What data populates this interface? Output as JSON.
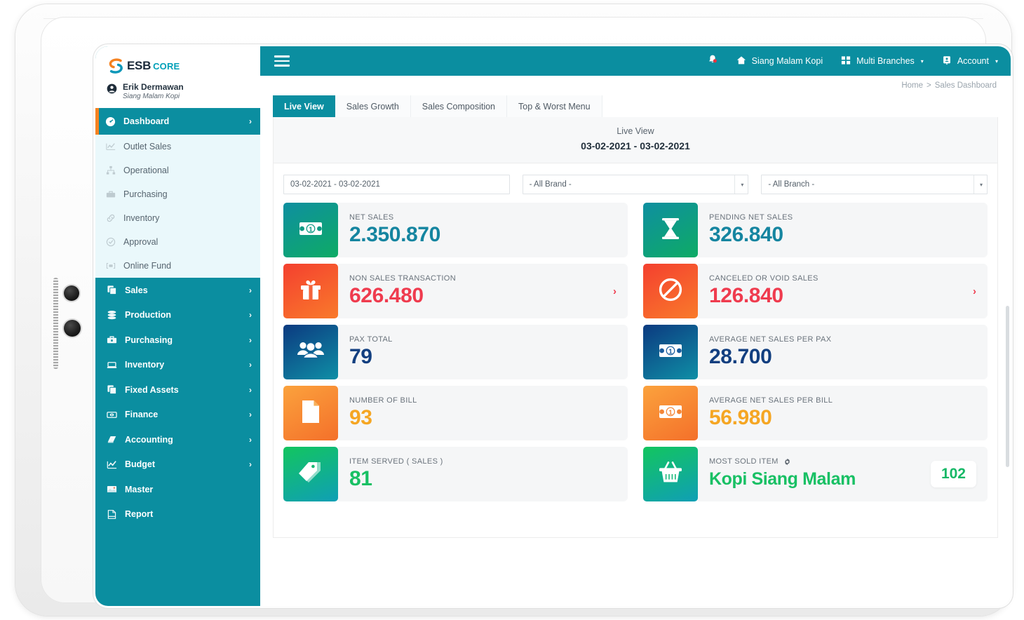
{
  "brand": {
    "logo_esb": "ESB",
    "logo_core": "CORE",
    "user_name": "Erik Dermawan",
    "user_company": "Siang Malam Kopi"
  },
  "sidebar": {
    "active_item": {
      "label": "Dashboard",
      "icon": "speedometer-icon",
      "chevron": "›"
    },
    "sub_items": [
      {
        "label": "Outlet Sales",
        "icon": "line-chart-icon"
      },
      {
        "label": "Operational",
        "icon": "sitemap-icon"
      },
      {
        "label": "Purchasing",
        "icon": "briefcase-icon"
      },
      {
        "label": "Inventory",
        "icon": "link-icon"
      },
      {
        "label": "Approval",
        "icon": "clock-check-icon"
      },
      {
        "label": "Online Fund",
        "icon": "money-bracket-icon"
      }
    ],
    "main_items": [
      {
        "label": "Sales",
        "icon": "copy-icon",
        "chevron": "›"
      },
      {
        "label": "Production",
        "icon": "layers-icon",
        "chevron": "›"
      },
      {
        "label": "Purchasing",
        "icon": "briefcase-icon",
        "chevron": "›"
      },
      {
        "label": "Inventory",
        "icon": "box-icon",
        "chevron": "›"
      },
      {
        "label": "Fixed Assets",
        "icon": "copy-icon",
        "chevron": "›"
      },
      {
        "label": "Finance",
        "icon": "wallet-eye-icon",
        "chevron": "›"
      },
      {
        "label": "Accounting",
        "icon": "book-icon",
        "chevron": "›"
      },
      {
        "label": "Budget",
        "icon": "line-chart-icon",
        "chevron": "›"
      },
      {
        "label": "Master",
        "icon": "image-icon",
        "chevron": ""
      },
      {
        "label": "Report",
        "icon": "document-icon",
        "chevron": ""
      }
    ]
  },
  "topbar": {
    "menu_icon": "hamburger-icon",
    "notification_icon": "bell-icon",
    "outlet": {
      "label": "Siang Malam Kopi",
      "icon": "home-icon"
    },
    "branches": {
      "label": "Multi Branches",
      "icon": "grid-icon",
      "caret": "▾"
    },
    "account": {
      "label": "Account",
      "icon": "id-card-icon",
      "caret": "▾"
    }
  },
  "breadcrumb": {
    "home": "Home",
    "separator": ">",
    "current": "Sales Dashboard"
  },
  "tabs": [
    {
      "label": "Live View",
      "active": true
    },
    {
      "label": "Sales Growth",
      "active": false
    },
    {
      "label": "Sales Composition",
      "active": false
    },
    {
      "label": "Top & Worst Menu",
      "active": false
    }
  ],
  "panel": {
    "title": "Live View",
    "date_range": "03-02-2021 - 03-02-2021"
  },
  "filters": [
    {
      "name": "date-range-filter",
      "value": "03-02-2021 - 03-02-2021",
      "has_caret": false
    },
    {
      "name": "brand-filter",
      "value": "- All Brand -",
      "has_caret": true,
      "caret": "▾"
    },
    {
      "name": "branch-filter",
      "value": "- All Branch -",
      "has_caret": true,
      "caret": "▾"
    }
  ],
  "kpis": [
    {
      "name": "net-sales",
      "label": "NET SALES",
      "value": "2.350.870",
      "value_color": "#1585a0",
      "icon": "banknote-icon",
      "icon_gradient": [
        "#0e8fa0",
        "#0eab65"
      ],
      "arrow": "",
      "arrow_color": ""
    },
    {
      "name": "pending-net-sales",
      "label": "PENDING NET SALES",
      "value": "326.840",
      "value_color": "#1585a0",
      "icon": "hourglass-icon",
      "icon_gradient": [
        "#0e8fa0",
        "#0eab65"
      ],
      "arrow": "",
      "arrow_color": ""
    },
    {
      "name": "non-sales-transaction",
      "label": "NON SALES TRANSACTION",
      "value": "626.480",
      "value_color": "#ef3b4e",
      "icon": "gift-icon",
      "icon_gradient": [
        "#f4402f",
        "#f97a2b"
      ],
      "arrow": "›",
      "arrow_color": "#ef3b4e"
    },
    {
      "name": "canceled-or-void-sales",
      "label": "CANCELED OR VOID SALES",
      "value": "126.840",
      "value_color": "#ef3b4e",
      "icon": "prohibited-icon",
      "icon_gradient": [
        "#f4402f",
        "#f97a2b"
      ],
      "arrow": "›",
      "arrow_color": "#ef3b4e"
    },
    {
      "name": "pax-total",
      "label": "PAX TOTAL",
      "value": "79",
      "value_color": "#123f80",
      "icon": "people-icon",
      "icon_gradient": [
        "#0c3a80",
        "#0f8fa6"
      ],
      "arrow": "",
      "arrow_color": ""
    },
    {
      "name": "average-net-sales-per-pax",
      "label": "AVERAGE NET SALES PER PAX",
      "value": "28.700",
      "value_color": "#123f80",
      "icon": "banknote-icon",
      "icon_gradient": [
        "#0c3a80",
        "#0f8fa6"
      ],
      "arrow": "",
      "arrow_color": ""
    },
    {
      "name": "number-of-bill",
      "label": "NUMBER OF BILL",
      "value": "93",
      "value_color": "#f5a623",
      "icon": "page-icon",
      "icon_gradient": [
        "#fba23d",
        "#f4702a"
      ],
      "arrow": "",
      "arrow_color": ""
    },
    {
      "name": "average-net-sales-per-bill",
      "label": "AVERAGE NET SALES PER BILL",
      "value": "56.980",
      "value_color": "#f5a623",
      "icon": "banknote-icon",
      "icon_gradient": [
        "#fba23d",
        "#f4702a"
      ],
      "arrow": "",
      "arrow_color": ""
    },
    {
      "name": "item-served-sales",
      "label": "ITEM SERVED ( SALES )",
      "value": "81",
      "value_color": "#18c064",
      "icon": "tag-icon",
      "icon_gradient": [
        "#13c55f",
        "#0f9fb5"
      ],
      "arrow": "",
      "arrow_color": ""
    },
    {
      "name": "most-sold-item",
      "label": "MOST SOLD ITEM",
      "value": "Kopi Siang Malam",
      "value_color": "#18c064",
      "icon": "basket-icon",
      "icon_gradient": [
        "#13c55f",
        "#0f9fb5"
      ],
      "arrow": "",
      "arrow_color": "",
      "settings_icon": "gear-icon",
      "badge": "102"
    }
  ],
  "theme": {
    "primary": "#0b8ea0",
    "accent_orange": "#f58220",
    "sub_nav_bg": "#eaf8fb"
  }
}
